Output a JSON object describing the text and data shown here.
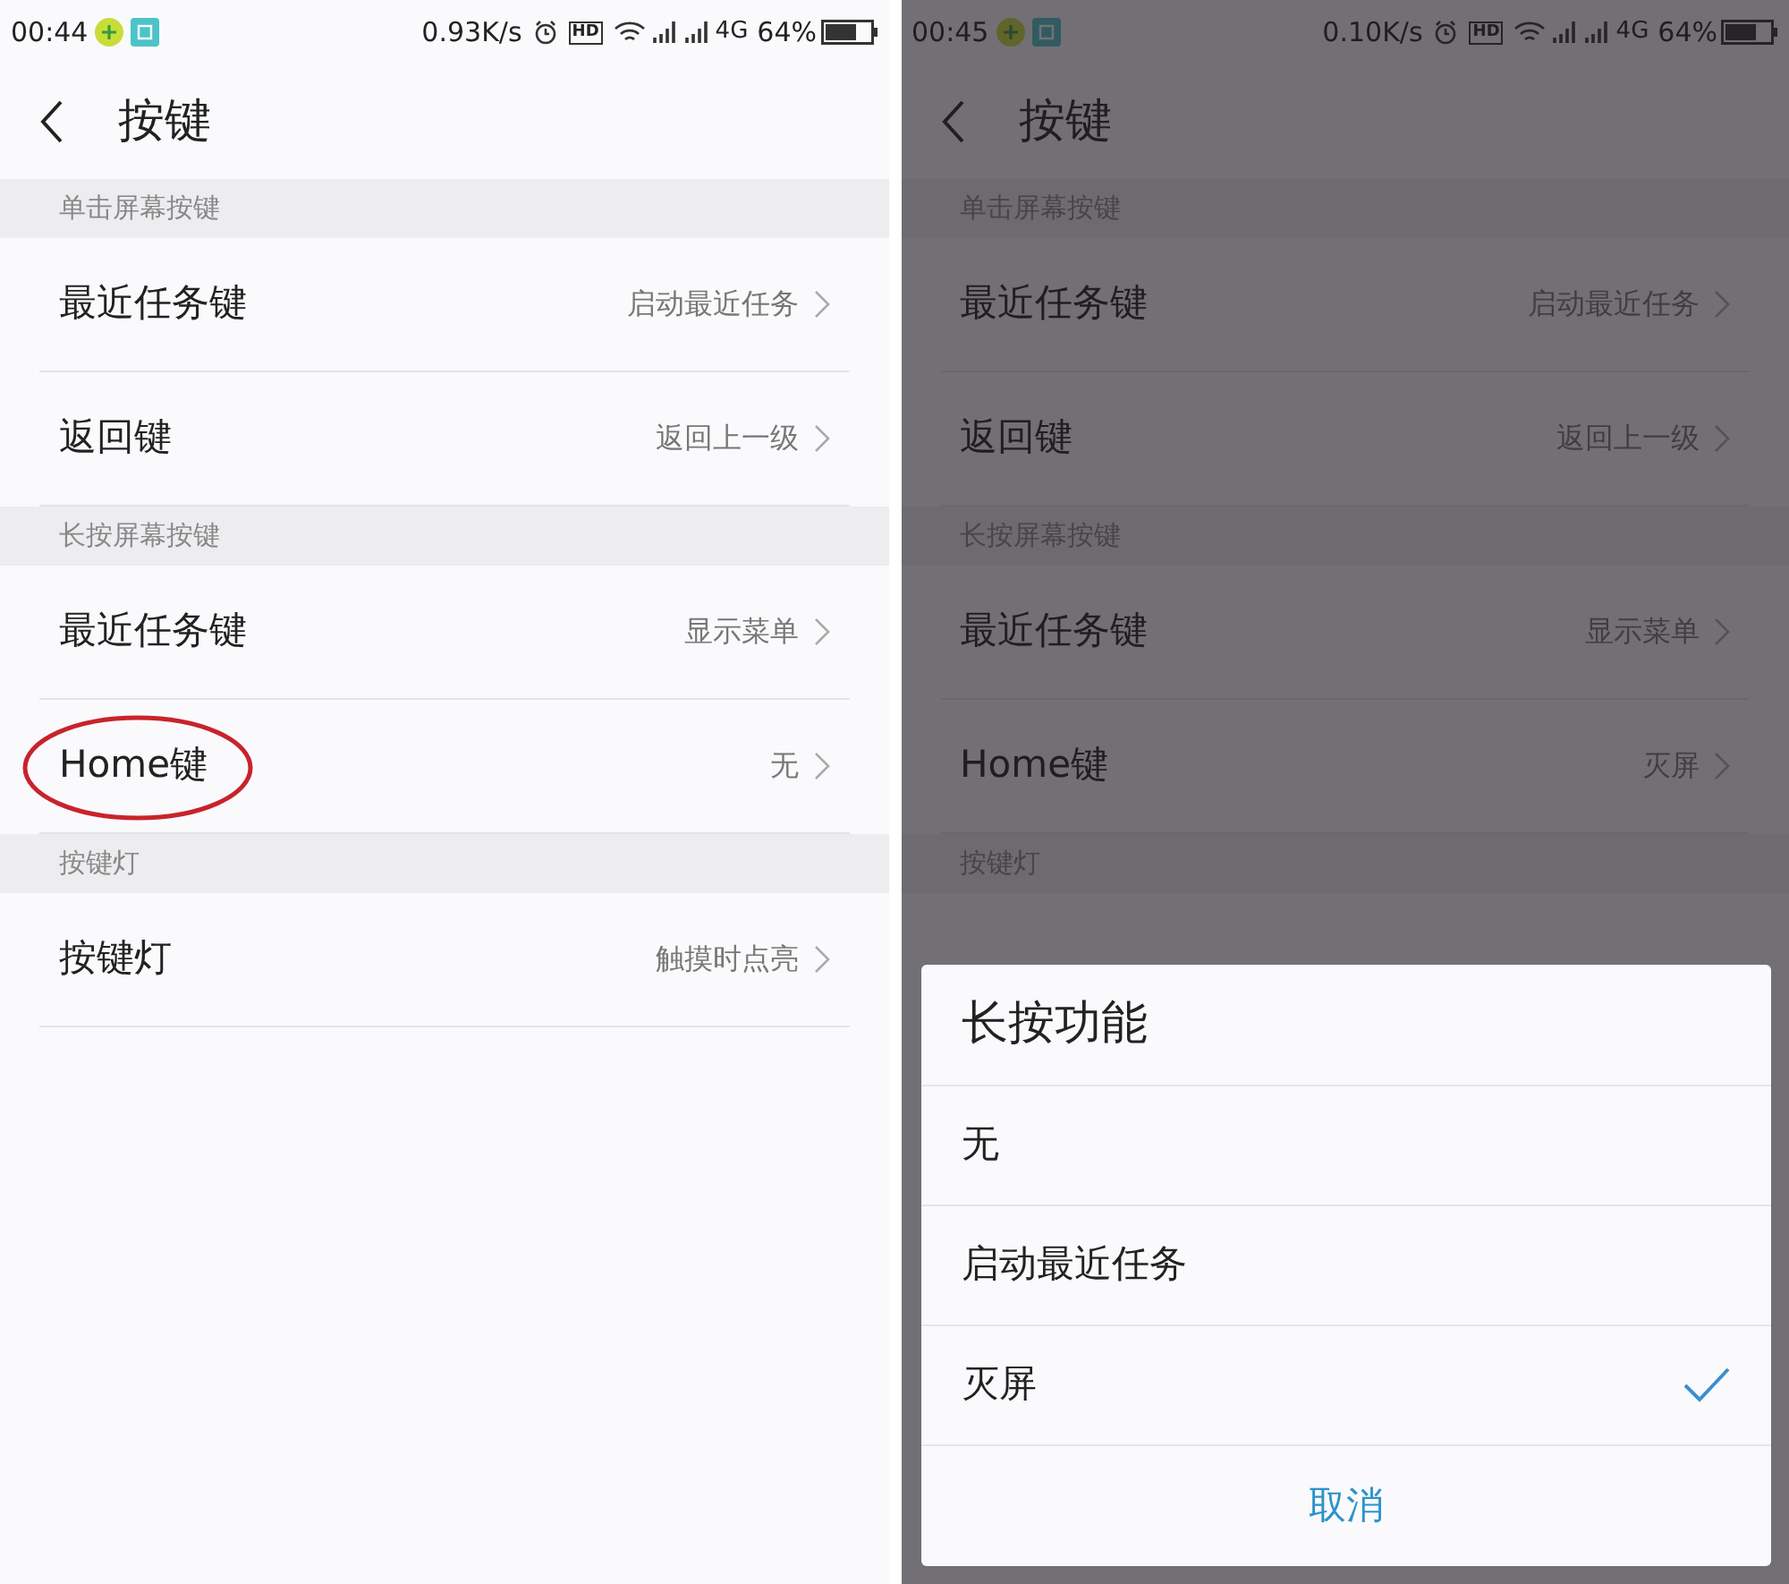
{
  "screens": [
    {
      "status_bar": {
        "time": "00:44",
        "speed": "0.93K/s",
        "hd": "HD",
        "network": "4G",
        "battery": "64%"
      },
      "title": "按键",
      "sections": [
        {
          "header": "单击屏幕按键",
          "rows": [
            {
              "label": "最近任务键",
              "value": "启动最近任务",
              "circled": false
            },
            {
              "label": "返回键",
              "value": "返回上一级",
              "circled": false
            }
          ]
        },
        {
          "header": "长按屏幕按键",
          "rows": [
            {
              "label": "最近任务键",
              "value": "显示菜单",
              "circled": false
            },
            {
              "label": "Home键",
              "value": "无",
              "circled": true
            }
          ]
        },
        {
          "header": "按键灯",
          "rows": [
            {
              "label": "按键灯",
              "value": "触摸时点亮",
              "circled": false
            }
          ]
        }
      ]
    },
    {
      "status_bar": {
        "time": "00:45",
        "speed": "0.10K/s",
        "hd": "HD",
        "network": "4G",
        "battery": "64%"
      },
      "title": "按键",
      "sections": [
        {
          "header": "单击屏幕按键",
          "rows": [
            {
              "label": "最近任务键",
              "value": "启动最近任务",
              "circled": false
            },
            {
              "label": "返回键",
              "value": "返回上一级",
              "circled": false
            }
          ]
        },
        {
          "header": "长按屏幕按键",
          "rows": [
            {
              "label": "最近任务键",
              "value": "显示菜单",
              "circled": false
            },
            {
              "label": "Home键",
              "value": "灭屏",
              "circled": false
            }
          ]
        },
        {
          "header": "按键灯"
        }
      ],
      "dialog": {
        "title": "长按功能",
        "options": [
          {
            "label": "无",
            "selected": false
          },
          {
            "label": "启动最近任务",
            "selected": false
          },
          {
            "label": "灭屏",
            "selected": true
          }
        ],
        "cancel": "取消"
      }
    }
  ]
}
